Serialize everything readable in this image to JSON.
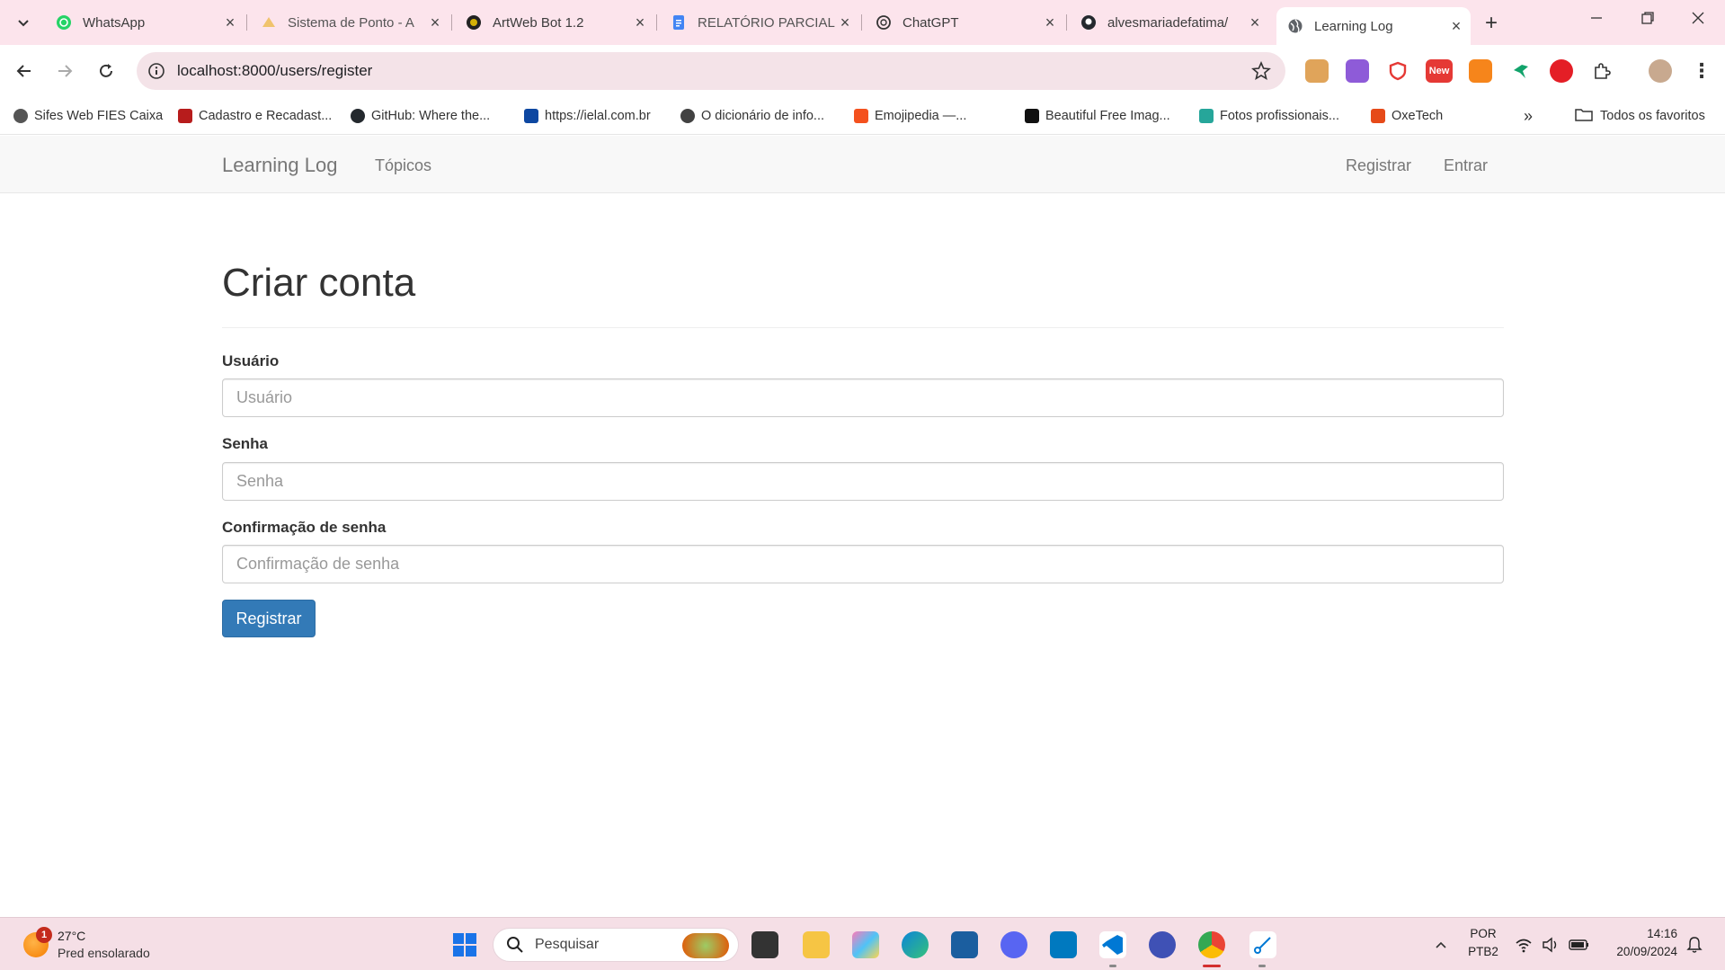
{
  "browser": {
    "tabs": [
      {
        "title": "WhatsApp",
        "icon": "whatsapp-icon"
      },
      {
        "title": "Sistema de Ponto - A",
        "icon": "ponto-icon"
      },
      {
        "title": "ArtWeb Bot 1.2",
        "icon": "artweb-icon"
      },
      {
        "title": "RELATÓRIO PARCIAL",
        "icon": "docs-icon"
      },
      {
        "title": "ChatGPT",
        "icon": "chatgpt-icon"
      },
      {
        "title": "alvesmariadefatima/",
        "icon": "github-icon"
      },
      {
        "title": "Learning Log",
        "icon": "globe-icon"
      }
    ],
    "url": "localhost:8000/users/register",
    "new_badge": "New",
    "bookmarks": [
      {
        "label": "Sifes Web FIES Caixa",
        "color": "#555555"
      },
      {
        "label": "Cadastro e Recadast...",
        "color": "#b71c1c"
      },
      {
        "label": "GitHub: Where the...",
        "color": "#24292e"
      },
      {
        "label": "https://ielal.com.br",
        "color": "#0d47a1"
      },
      {
        "label": "O dicionário de info...",
        "color": "#424242"
      },
      {
        "label": "Emojipedia —...",
        "color": "#f4511e"
      },
      {
        "label": "Beautiful Free Imag...",
        "color": "#111111"
      },
      {
        "label": "Fotos profissionais...",
        "color": "#26a69a"
      },
      {
        "label": "OxeTech",
        "color": "#e64a19"
      }
    ],
    "all_bookmarks": "Todos os favoritos"
  },
  "site": {
    "brand": "Learning Log",
    "nav_topics": "Tópicos",
    "nav_register": "Registrar",
    "nav_login": "Entrar"
  },
  "form": {
    "title": "Criar conta",
    "username_label": "Usuário",
    "username_placeholder": "Usuário",
    "password_label": "Senha",
    "password_placeholder": "Senha",
    "confirm_label": "Confirmação de senha",
    "confirm_placeholder": "Confirmação de senha",
    "submit_label": "Registrar",
    "accent": "#337ab7"
  },
  "taskbar": {
    "weather_temp": "27°C",
    "weather_desc": "Pred ensolarado",
    "weather_badge": "1",
    "search_label": "Pesquisar",
    "lang_top": "POR",
    "lang_bottom": "PTB2",
    "time": "14:16",
    "date": "20/09/2024"
  }
}
